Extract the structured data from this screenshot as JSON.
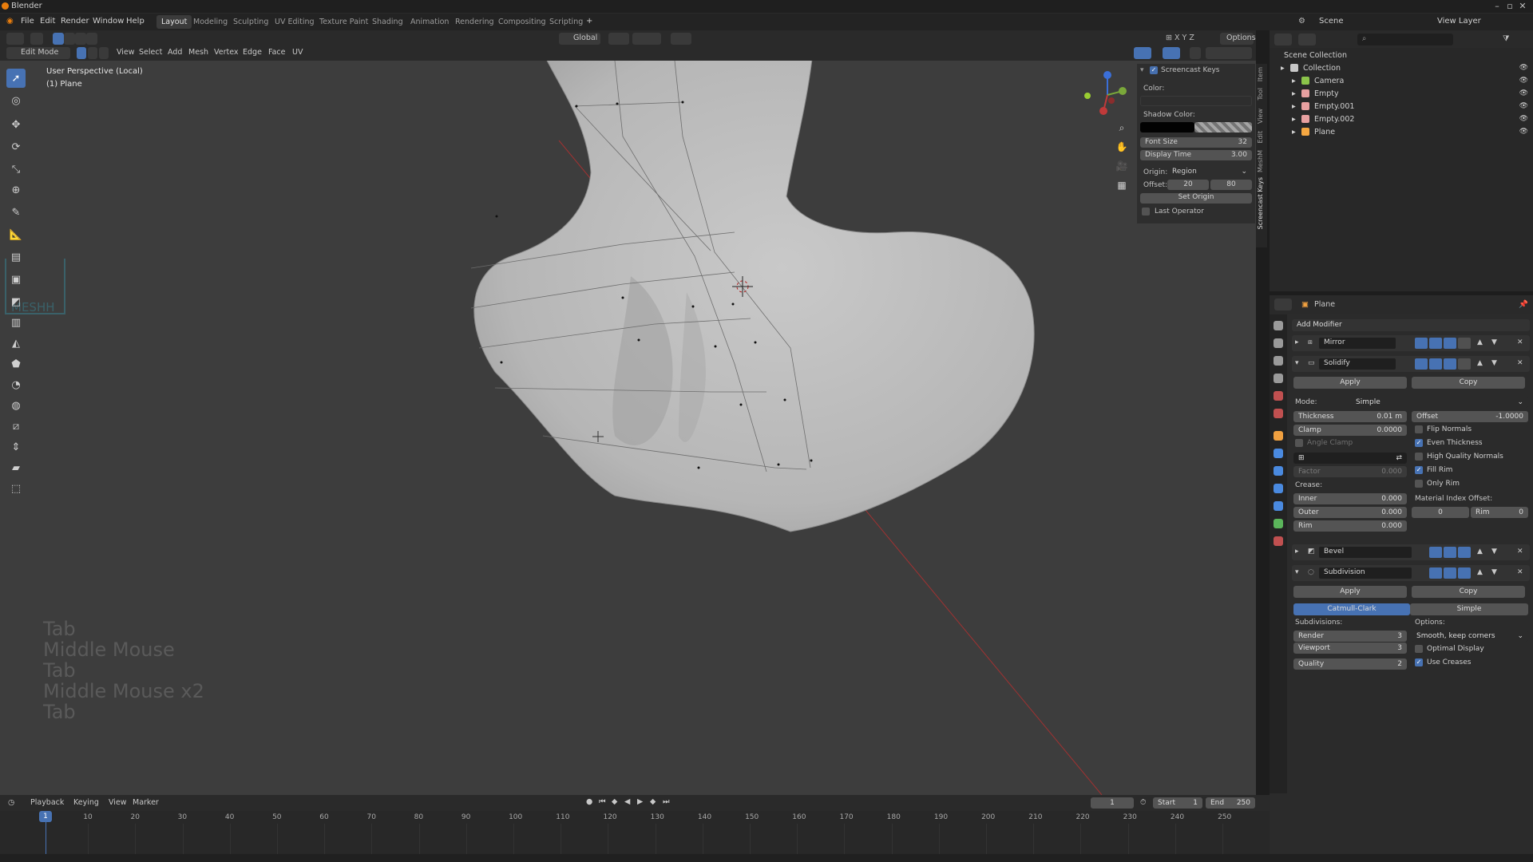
{
  "window": {
    "title": "Blender"
  },
  "menu": {
    "items": [
      "File",
      "Edit",
      "Render",
      "Window",
      "Help"
    ],
    "workspaces": [
      "Layout",
      "Modeling",
      "Sculpting",
      "UV Editing",
      "Texture Paint",
      "Shading",
      "Animation",
      "Rendering",
      "Compositing",
      "Scripting"
    ],
    "scene_label": "Scene",
    "view_layer_label": "View Layer"
  },
  "viewport_header": {
    "mode": "Edit Mode",
    "menus": [
      "View",
      "Select",
      "Add",
      "Mesh",
      "Vertex",
      "Edge",
      "Face",
      "UV"
    ],
    "transform_orientation": "Global",
    "options_label": "Options"
  },
  "viewport": {
    "perspective_label": "User Perspective (Local)",
    "object_label": "(1) Plane",
    "screencast_keys": [
      "Tab",
      "Middle Mouse",
      "Tab",
      "Middle Mouse x2",
      "Tab"
    ],
    "watermark": "MESHH"
  },
  "screencast_panel": {
    "header": "Screencast Keys",
    "color_label": "Color:",
    "shadow_color_label": "Shadow Color:",
    "font_size_label": "Font Size",
    "font_size_value": "32",
    "display_time_label": "Display Time",
    "display_time_value": "3.00",
    "origin_label": "Origin:",
    "origin_value": "Region",
    "offset_label": "Offset:",
    "offset_x": "20",
    "offset_y": "80",
    "set_origin_label": "Set Origin",
    "last_operator_label": "Last Operator",
    "tabs": [
      "Item",
      "Tool",
      "View",
      "Edit",
      "MeshM",
      "Screencast Keys"
    ]
  },
  "outliner": {
    "root": "Scene Collection",
    "items": [
      {
        "name": "Collection",
        "color": "#c8c8c8",
        "indent": 1
      },
      {
        "name": "Camera",
        "color": "#8bc34a",
        "indent": 2
      },
      {
        "name": "Empty",
        "color": "#e8a0a0",
        "indent": 2
      },
      {
        "name": "Empty.001",
        "color": "#e8a0a0",
        "indent": 2
      },
      {
        "name": "Empty.002",
        "color": "#e8a0a0",
        "indent": 2
      },
      {
        "name": "Plane",
        "color": "#f5a742",
        "indent": 2
      }
    ]
  },
  "properties": {
    "object_name": "Plane",
    "add_modifier_label": "Add Modifier",
    "mirror": {
      "name": "Mirror"
    },
    "solidify": {
      "name": "Solidify",
      "apply_label": "Apply",
      "copy_label": "Copy",
      "mode_label": "Mode:",
      "mode_value": "Simple",
      "thickness_label": "Thickness",
      "thickness_value": "0.01 m",
      "offset_label": "Offset",
      "offset_value": "-1.0000",
      "clamp_label": "Clamp",
      "clamp_value": "0.0000",
      "angle_clamp_label": "Angle Clamp",
      "factor_label": "Factor",
      "factor_value": "0.000",
      "flip_normals_label": "Flip Normals",
      "even_thickness_label": "Even Thickness",
      "high_quality_normals_label": "High Quality Normals",
      "fill_rim_label": "Fill Rim",
      "only_rim_label": "Only Rim",
      "crease_label": "Crease:",
      "inner_label": "Inner",
      "inner_value": "0.000",
      "outer_label": "Outer",
      "outer_value": "0.000",
      "rim_label": "Rim",
      "rim_value": "0.000",
      "material_index_offset_label": "Material Index Offset:",
      "material_index_value": "0",
      "material_rim_label": "Rim",
      "material_rim_value": "0"
    },
    "bevel": {
      "name": "Bevel"
    },
    "subdivision": {
      "name": "Subdivision",
      "apply_label": "Apply",
      "copy_label": "Copy",
      "catmull_clark_label": "Catmull-Clark",
      "simple_label": "Simple",
      "subdivisions_label": "Subdivisions:",
      "options_label": "Options:",
      "render_label": "Render",
      "render_value": "3",
      "viewport_label": "Viewport",
      "viewport_value": "3",
      "quality_label": "Quality",
      "quality_value": "2",
      "uv_smooth_value": "Smooth, keep corners",
      "optimal_display_label": "Optimal Display",
      "use_creases_label": "Use Creases"
    }
  },
  "timeline": {
    "menus": [
      "Playback",
      "Keying",
      "View",
      "Marker"
    ],
    "current_frame": "1",
    "start_label": "Start",
    "start_value": "1",
    "end_label": "End",
    "end_value": "250",
    "ticks": [
      "10",
      "20",
      "30",
      "40",
      "50",
      "60",
      "70",
      "80",
      "90",
      "100",
      "110",
      "120",
      "130",
      "140",
      "150",
      "160",
      "170",
      "180",
      "190",
      "200",
      "210",
      "220",
      "230",
      "240",
      "250"
    ]
  },
  "colors": {
    "accent": "#4772b3",
    "viewport_bg": "#3d3d3d",
    "panel_bg": "#2b2b2b",
    "mesh": "#c4c4c4"
  }
}
